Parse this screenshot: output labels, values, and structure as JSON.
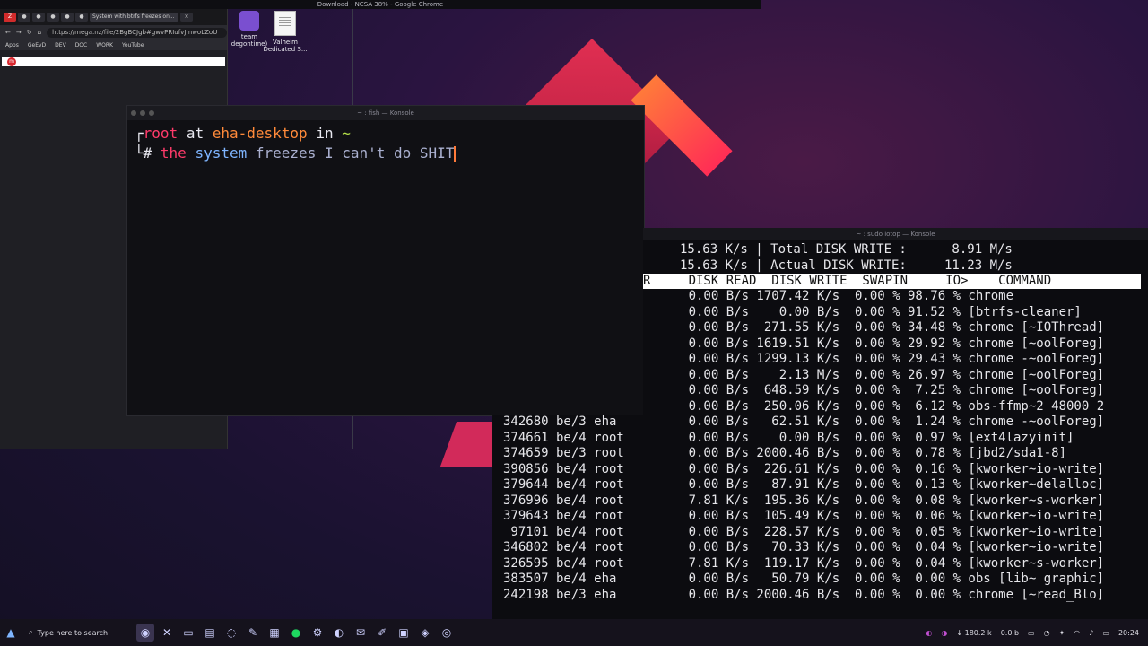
{
  "top_title": "Download - NCSA 38% - Google Chrome",
  "desktop": {
    "icons": [
      {
        "label_line1": "team",
        "label_line2": "degontime)"
      },
      {
        "label_line1": "Valheim",
        "label_line2": "Dedicated S..."
      }
    ]
  },
  "chrome": {
    "active_tab": "System with btrfs freezes on...",
    "url": "https://mega.nz/file/2BgBCJgb#gwvPRIufvJmwoLZoU",
    "bookmarks": [
      "Apps",
      "GeEvD",
      "DEV",
      "DOC",
      "WORK",
      "YouTube"
    ]
  },
  "fish": {
    "title": "~ : fish — Konsole",
    "prompt_user": "root",
    "prompt_at": "at",
    "prompt_host": "eha-desktop",
    "prompt_in": "in",
    "prompt_dir": "~",
    "cmd_the": "the",
    "cmd_system": "system",
    "cmd_rest": "freezes I can't do SHIT"
  },
  "iotop": {
    "title": "~ : sudo iotop — Konsole",
    "summary": [
      "15.63 K/s | Total DISK WRITE :      8.91 M/s",
      "15.63 K/s | Actual DISK WRITE:     11.23 M/s"
    ],
    "header": "R     DISK READ  DISK WRITE  SWAPIN     IO>    COMMAND",
    "rows": [
      "      0.00 B/s 1707.42 K/s  0.00 % 98.76 % chrome",
      "      0.00 B/s    0.00 B/s  0.00 % 91.52 % [btrfs-cleaner]",
      "      0.00 B/s  271.55 K/s  0.00 % 34.48 % chrome [~IOThread]",
      "      0.00 B/s 1619.51 K/s  0.00 % 29.92 % chrome [~oolForeg]",
      "      0.00 B/s 1299.13 K/s  0.00 % 29.43 % chrome -~oolForeg]",
      "      0.00 B/s    2.13 M/s  0.00 % 26.97 % chrome [~oolForeg]",
      "      0.00 B/s  648.59 K/s  0.00 %  7.25 % chrome [~oolForeg]",
      "      0.00 B/s  250.06 K/s  0.00 %  6.12 % obs-ffmp~2 48000 2",
      "      0.00 B/s   62.51 K/s  0.00 %  1.24 % chrome -~oolForeg]",
      "      0.00 B/s    0.00 B/s  0.00 %  0.97 % [ext4lazyinit]",
      "      0.00 B/s 2000.46 B/s  0.00 %  0.78 % [jbd2/sda1-8]",
      "      0.00 B/s  226.61 K/s  0.00 %  0.16 % [kworker~io-write]",
      "      0.00 B/s   87.91 K/s  0.00 %  0.13 % [kworker~delalloc]",
      "      7.81 K/s  195.36 K/s  0.00 %  0.08 % [kworker~s-worker]",
      "      0.00 B/s  105.49 K/s  0.00 %  0.06 % [kworker~io-write]",
      "      0.00 B/s  228.57 K/s  0.00 %  0.05 % [kworker~io-write]",
      "      0.00 B/s   70.33 K/s  0.00 %  0.04 % [kworker~io-write]",
      "      7.81 K/s  119.17 K/s  0.00 %  0.04 % [kworker~s-worker]",
      "      0.00 B/s   50.79 K/s  0.00 %  0.00 % obs [lib~ graphic]",
      "      0.00 B/s 2000.46 B/s  0.00 %  0.00 % chrome [~read_Blo]"
    ],
    "left_rows": [
      "342680 be/3 eha",
      "374661 be/4 root",
      "374659 be/3 root",
      "390856 be/4 root",
      "379644 be/4 root",
      "376996 be/4 root",
      "379643 be/4 root",
      " 97101 be/4 root",
      "346802 be/4 root",
      "326595 be/4 root",
      "383507 be/4 eha",
      "242198 be/3 eha"
    ]
  },
  "taskbar": {
    "search_placeholder": "Type here to search",
    "tray_net_down": "180.2 k",
    "tray_net_up": "0.0 b",
    "clock": "20:24"
  }
}
